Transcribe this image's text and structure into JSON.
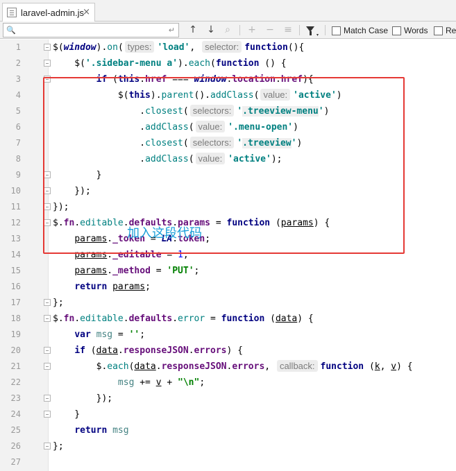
{
  "tab": {
    "title": "laravel-admin.js",
    "close": "×"
  },
  "findbar": {
    "search_icon": "🔍",
    "search_value": "",
    "enter_glyph": "↵",
    "up": "↑",
    "down": "↓",
    "find_occurrence": "⌕",
    "add_selection": "+",
    "remove_selection": "−",
    "select_all": "≡",
    "caret": "▾",
    "match_case": "Match Case",
    "words": "Words",
    "regex": "Regex"
  },
  "annotation": "加入这段代码",
  "line_numbers": [
    "1",
    "2",
    "3",
    "4",
    "5",
    "6",
    "7",
    "8",
    "9",
    "10",
    "11",
    "12",
    "13",
    "14",
    "15",
    "16",
    "17",
    "18",
    "19",
    "20",
    "21",
    "22",
    "23",
    "24",
    "25",
    "26",
    "27"
  ],
  "hints": {
    "types": "types:",
    "selector": "selector:",
    "value": "value:",
    "selectors": "selectors:",
    "callback": "callback:"
  },
  "code": {
    "l1": [
      "$(",
      "window",
      ").",
      "on",
      "(",
      "'load'",
      ", ",
      "function",
      "(){"
    ],
    "l2": [
      "    $(",
      "'.sidebar-menu a'",
      ").",
      "each",
      "(",
      "function",
      " () {"
    ],
    "l3": [
      "        ",
      "if",
      " (",
      "this",
      ".",
      "href",
      " === ",
      "window",
      ".",
      "location",
      ".",
      "href",
      "){"
    ],
    "l4": [
      "            $(",
      "this",
      ").",
      "parent",
      "().",
      "addClass",
      "(",
      "'active'",
      ")"
    ],
    "l5": [
      "                .",
      "closest",
      "(",
      "'",
      ".treeview-menu",
      "'",
      ")"
    ],
    "l6": [
      "                .",
      "addClass",
      "(",
      "'.menu-open'",
      ")"
    ],
    "l7": [
      "                .",
      "closest",
      "(",
      "'",
      ".treeview",
      "'",
      ")"
    ],
    "l8": [
      "                .",
      "addClass",
      "(",
      "'active'",
      ");"
    ],
    "l9": [
      "        }"
    ],
    "l10": [
      "    });"
    ],
    "l11": [
      "});"
    ],
    "l12": [
      "$.",
      "fn",
      ".",
      "editable",
      ".",
      "defaults",
      ".",
      "params",
      " = ",
      "function",
      " (",
      "params",
      ") {"
    ],
    "l13": [
      "    ",
      "params",
      ".",
      "_token",
      " = ",
      "LA",
      ".",
      "token",
      ";"
    ],
    "l14": [
      "    ",
      "params",
      ".",
      "_editable",
      " = ",
      "1",
      ";"
    ],
    "l15": [
      "    ",
      "params",
      ".",
      "_method",
      " = ",
      "'PUT'",
      ";"
    ],
    "l16": [
      "    ",
      "return",
      " ",
      "params",
      ";"
    ],
    "l17": [
      "};"
    ],
    "l18": [
      "$.",
      "fn",
      ".",
      "editable",
      ".",
      "defaults",
      ".",
      "error",
      " = ",
      "function",
      " (",
      "data",
      ") {"
    ],
    "l19": [
      "    ",
      "var",
      " ",
      "msg",
      " = ",
      "''",
      ";"
    ],
    "l20": [
      "    ",
      "if",
      " (",
      "data",
      ".",
      "responseJSON",
      ".",
      "errors",
      ") {"
    ],
    "l21": [
      "        $.",
      "each",
      "(",
      "data",
      ".",
      "responseJSON",
      ".",
      "errors",
      ", ",
      "function",
      " (",
      "k",
      ", ",
      "v",
      ") {"
    ],
    "l22": [
      "            ",
      "msg",
      " += ",
      "v",
      " + ",
      "\"\\n\"",
      ";"
    ],
    "l23": [
      "        });"
    ],
    "l24": [
      "    }"
    ],
    "l25": [
      "    ",
      "return",
      " ",
      "msg"
    ],
    "l26": [
      "};"
    ],
    "l27": [
      ""
    ]
  }
}
